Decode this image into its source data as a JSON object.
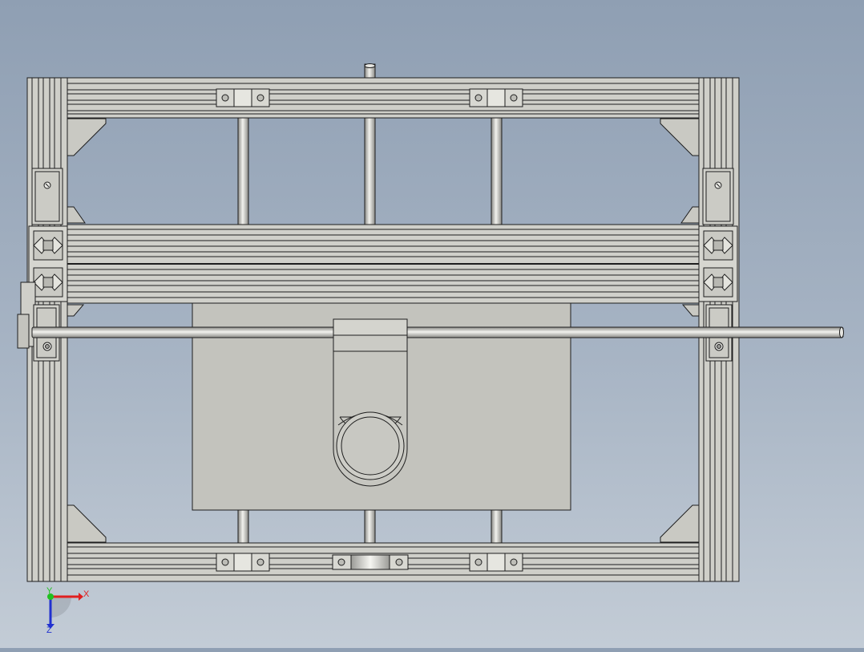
{
  "viewport": {
    "background_top": "#8f9fb3",
    "background_bottom": "#c3ccd6",
    "part_fill": "#c9c9c3",
    "part_stroke": "#1e1e1e"
  },
  "triad": {
    "x_label": "X",
    "y_label": "Y",
    "z_label": "Z",
    "x_color": "#e02020",
    "y_color": "#20c020",
    "z_color": "#2030d0"
  }
}
